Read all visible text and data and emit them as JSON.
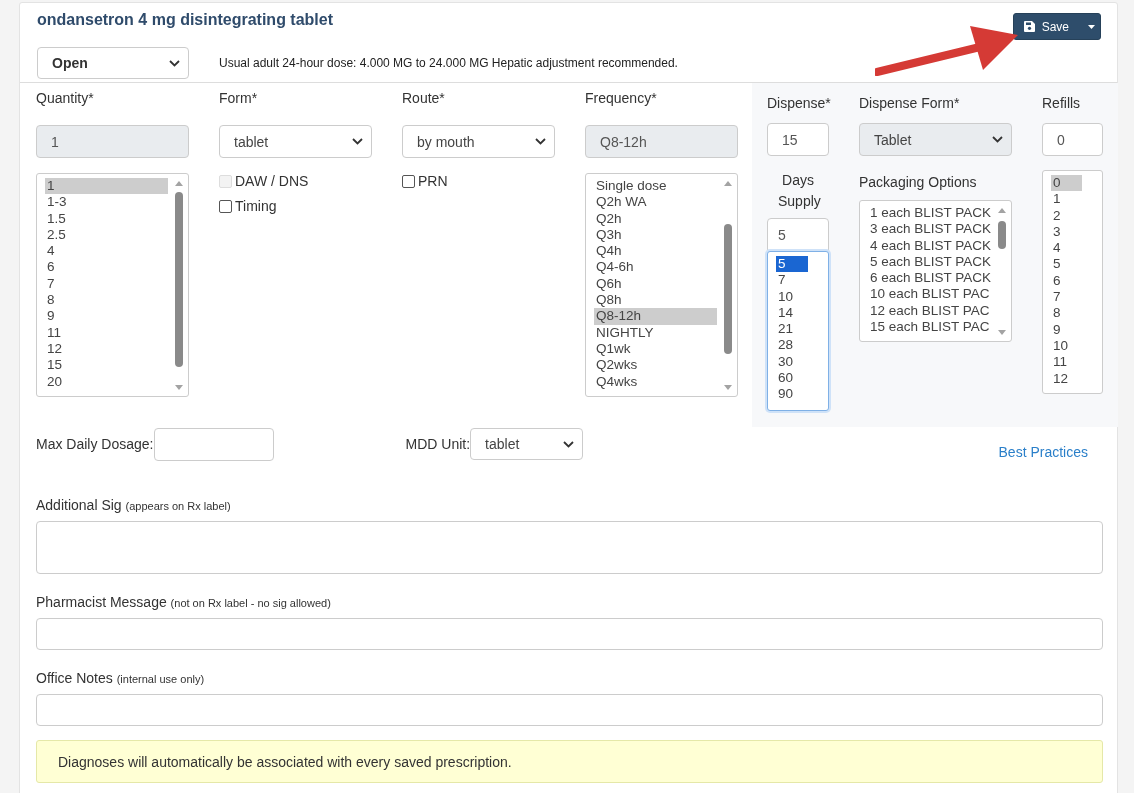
{
  "title": "ondansetron 4 mg disintegrating tablet",
  "save_button": {
    "label": "Save"
  },
  "status_select": {
    "value": "Open"
  },
  "dose_note": "Usual adult 24-hour dose: 4.000 MG to 24.000 MG Hepatic adjustment recommended.",
  "columns": [
    {
      "label": "Quantity*",
      "kind": "readonly",
      "value": "1",
      "options": [
        {
          "label": "1",
          "selected": true
        },
        {
          "label": "1-3",
          "selected": false
        },
        {
          "label": "1.5",
          "selected": false
        },
        {
          "label": "2.5",
          "selected": false
        },
        {
          "label": "4",
          "selected": false
        },
        {
          "label": "6",
          "selected": false
        },
        {
          "label": "7",
          "selected": false
        },
        {
          "label": "8",
          "selected": false
        },
        {
          "label": "9",
          "selected": false
        },
        {
          "label": "11",
          "selected": false
        },
        {
          "label": "12",
          "selected": false
        },
        {
          "label": "15",
          "selected": false
        },
        {
          "label": "20",
          "selected": false
        }
      ]
    },
    {
      "label": "Form*",
      "kind": "select",
      "value": "tablet",
      "checkboxes": [
        {
          "label": "DAW / DNS",
          "checked": false,
          "disabled": true
        },
        {
          "label": "Timing",
          "checked": false,
          "disabled": false
        }
      ]
    },
    {
      "label": "Route*",
      "kind": "select",
      "value": "by mouth",
      "checkboxes": [
        {
          "label": "PRN",
          "checked": false,
          "disabled": false
        }
      ]
    },
    {
      "label": "Frequency*",
      "kind": "readonly",
      "value": "Q8-12h",
      "options": [
        {
          "label": "Single dose",
          "selected": false
        },
        {
          "label": "Q2h WA",
          "selected": false
        },
        {
          "label": "Q2h",
          "selected": false
        },
        {
          "label": "Q3h",
          "selected": false
        },
        {
          "label": "Q4h",
          "selected": false
        },
        {
          "label": "Q4-6h",
          "selected": false
        },
        {
          "label": "Q6h",
          "selected": false
        },
        {
          "label": "Q8h",
          "selected": false
        },
        {
          "label": "Q8-12h",
          "selected": true
        },
        {
          "label": "NIGHTLY",
          "selected": false
        },
        {
          "label": "Q1wk",
          "selected": false
        },
        {
          "label": "Q2wks",
          "selected": false
        },
        {
          "label": "Q4wks",
          "selected": false
        }
      ]
    }
  ],
  "dispense": {
    "label": "Dispense*",
    "value": "15"
  },
  "days_supply": {
    "label": "Days Supply",
    "value": "5",
    "focused": true,
    "options": [
      {
        "label": "5",
        "selected": true
      },
      {
        "label": "7",
        "selected": false
      },
      {
        "label": "10",
        "selected": false
      },
      {
        "label": "14",
        "selected": false
      },
      {
        "label": "21",
        "selected": false
      },
      {
        "label": "28",
        "selected": false
      },
      {
        "label": "30",
        "selected": false
      },
      {
        "label": "60",
        "selected": false
      },
      {
        "label": "90",
        "selected": false
      }
    ]
  },
  "dispense_form": {
    "label": "Dispense Form*",
    "value": "Tablet"
  },
  "packaging_options": {
    "label": "Packaging Options",
    "options": [
      {
        "label": "1 each BLIST PACK",
        "selected": false
      },
      {
        "label": "3 each BLIST PACK",
        "selected": false
      },
      {
        "label": "4 each BLIST PACK",
        "selected": false
      },
      {
        "label": "5 each BLIST PACK",
        "selected": false
      },
      {
        "label": "6 each BLIST PACK",
        "selected": false
      },
      {
        "label": "10 each BLIST PAC",
        "selected": false
      },
      {
        "label": "12 each BLIST PAC",
        "selected": false
      },
      {
        "label": "15 each BLIST PAC",
        "selected": false
      }
    ]
  },
  "refills": {
    "label": "Refills",
    "value": "0",
    "options": [
      {
        "label": "0",
        "selected": true
      },
      {
        "label": "1",
        "selected": false
      },
      {
        "label": "2",
        "selected": false
      },
      {
        "label": "3",
        "selected": false
      },
      {
        "label": "4",
        "selected": false
      },
      {
        "label": "5",
        "selected": false
      },
      {
        "label": "6",
        "selected": false
      },
      {
        "label": "7",
        "selected": false
      },
      {
        "label": "8",
        "selected": false
      },
      {
        "label": "9",
        "selected": false
      },
      {
        "label": "10",
        "selected": false
      },
      {
        "label": "11",
        "selected": false
      },
      {
        "label": "12",
        "selected": false
      }
    ]
  },
  "max_daily_dosage": {
    "label": "Max Daily Dosage:"
  },
  "mdd_unit": {
    "label": "MDD Unit:",
    "value": "tablet"
  },
  "best_practices_link": "Best Practices",
  "notes": [
    {
      "label": "Additional Sig",
      "hint": "(appears on Rx label)",
      "kind": "textarea"
    },
    {
      "label": "Pharmacist Message",
      "hint": "(not on Rx label - no sig allowed)",
      "kind": "input"
    },
    {
      "label": "Office Notes",
      "hint": "(internal use only)",
      "kind": "input"
    }
  ],
  "alert": "Diagnoses will automatically be associated with every saved prescription."
}
